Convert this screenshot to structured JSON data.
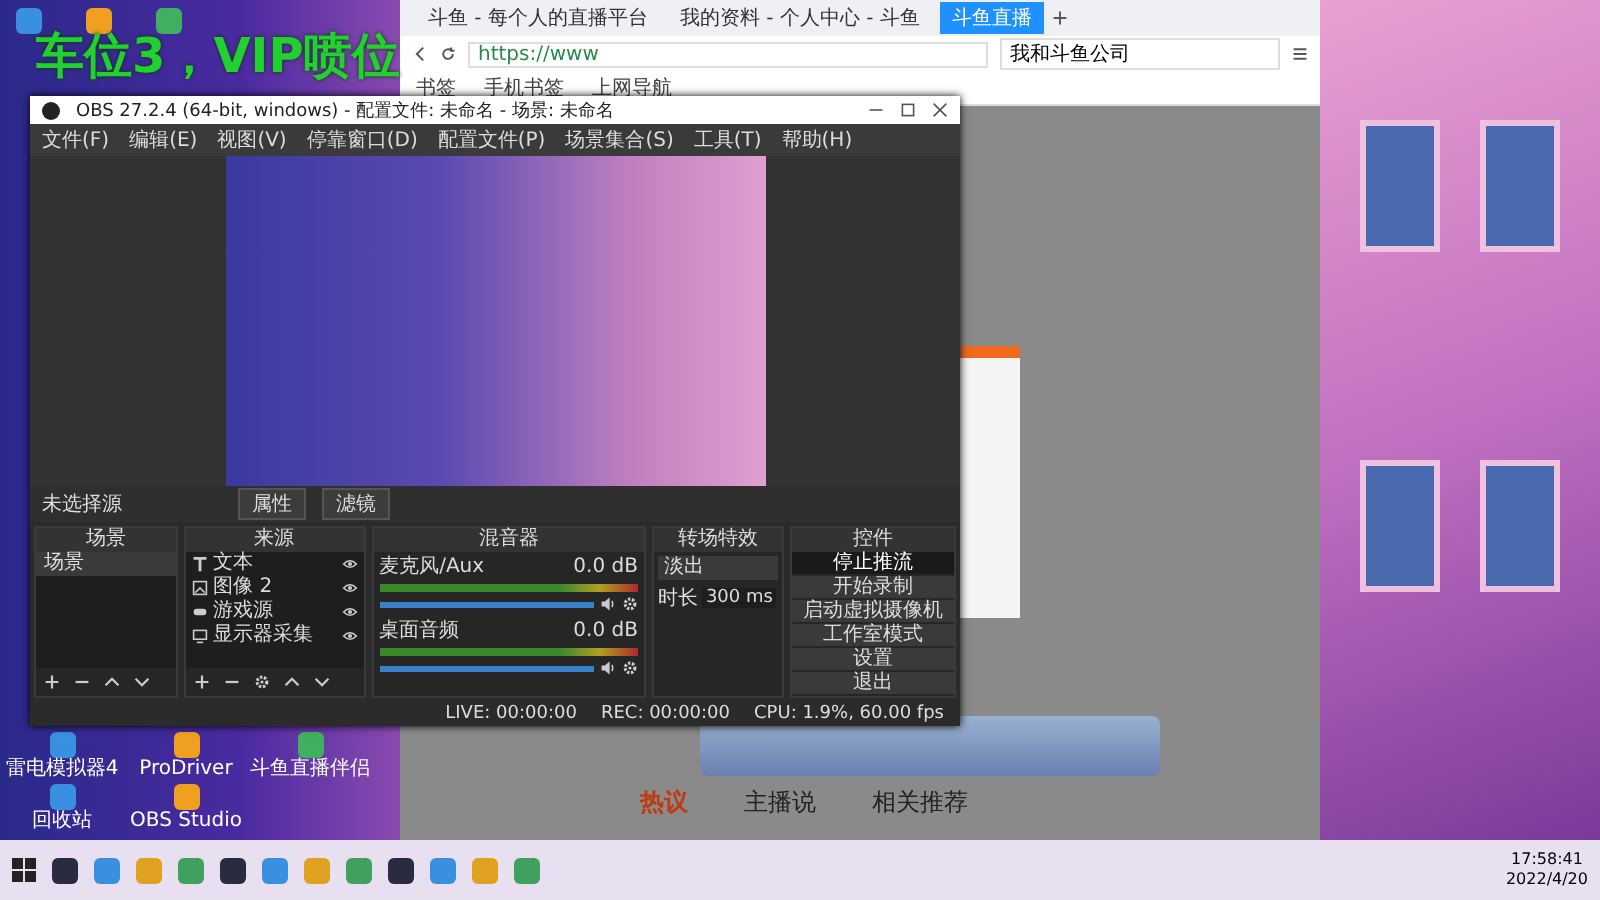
{
  "overlay_text": "车位3，VIP喷位",
  "desktop_icons": [
    {
      "label": "雷电模拟器4"
    },
    {
      "label": "ProDriver"
    },
    {
      "label": "斗鱼直播伴侣"
    },
    {
      "label": "回收站"
    },
    {
      "label": "OBS Studio"
    }
  ],
  "browser": {
    "tabs": [
      {
        "label": "斗鱼 - 每个人的直播平台",
        "selected": false
      },
      {
        "label": "我的资料 - 个人中心 - 斗鱼",
        "selected": false
      },
      {
        "label": "斗鱼直播",
        "selected": true
      }
    ],
    "address": "https://www",
    "search": "我和斗鱼公司",
    "bookmarks": [
      "书签",
      "手机书签",
      "上网导航"
    ],
    "page_tabs": [
      {
        "label": "热议",
        "selected": true
      },
      {
        "label": "主播说",
        "selected": false
      },
      {
        "label": "相关推荐",
        "selected": false
      }
    ]
  },
  "obs": {
    "title": "OBS 27.2.4 (64-bit, windows) - 配置文件: 未命名 - 场景: 未命名",
    "menu": [
      "文件(F)",
      "编辑(E)",
      "视图(V)",
      "停靠窗口(D)",
      "配置文件(P)",
      "场景集合(S)",
      "工具(T)",
      "帮助(H)"
    ],
    "source_status": "未选择源",
    "source_buttons": [
      "属性",
      "滤镜"
    ],
    "scenes": {
      "title": "场景",
      "items": [
        {
          "label": "场景",
          "selected": true
        }
      ]
    },
    "sources": {
      "title": "来源",
      "items": [
        {
          "label": "文本",
          "kind": "text"
        },
        {
          "label": "图像 2",
          "kind": "image"
        },
        {
          "label": "游戏源",
          "kind": "game"
        },
        {
          "label": "显示器采集",
          "kind": "display"
        }
      ]
    },
    "mixer": {
      "title": "混音器",
      "channels": [
        {
          "name": "麦克风/Aux",
          "reading": "0.0 dB",
          "level": 1
        },
        {
          "name": "桌面音频",
          "reading": "0.0 dB",
          "level": 1
        }
      ]
    },
    "transitions": {
      "title": "转场特效",
      "type": "淡出",
      "duration_label": "时长",
      "duration": "300 ms"
    },
    "controls": {
      "title": "控件",
      "buttons": [
        {
          "label": "停止推流",
          "active": true
        },
        {
          "label": "开始录制",
          "active": false
        },
        {
          "label": "启动虚拟摄像机",
          "active": false
        },
        {
          "label": "工作室模式",
          "active": false
        },
        {
          "label": "设置",
          "active": false
        },
        {
          "label": "退出",
          "active": false
        }
      ]
    },
    "status": {
      "live": "LIVE: 00:00:00",
      "rec": "REC: 00:00:00",
      "cpu": "CPU: 1.9%, 60.00 fps"
    }
  },
  "taskbar": {
    "time": "17:58:41",
    "date": "2022/4/20"
  }
}
